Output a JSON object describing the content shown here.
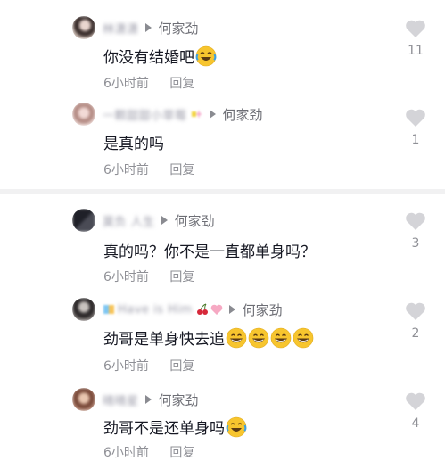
{
  "comments": [
    {
      "username": "林潇潇",
      "reply_to": "何家劲",
      "text": "你没有结婚吧",
      "time": "6小时前",
      "reply_label": "回复",
      "likes": "11",
      "emoji": [
        "laughing-tears-emoji"
      ]
    },
    {
      "username": "一颗甜甜小草莓",
      "reply_to": "何家劲",
      "text": "是真的吗",
      "time": "6小时前",
      "reply_label": "回复",
      "likes": "1",
      "emoji": []
    },
    {
      "username": "莫负 人生",
      "reply_to": "何家劲",
      "text": "真的吗？你不是一直都单身吗？",
      "time": "6小时前",
      "reply_label": "回复",
      "likes": "3",
      "emoji": []
    },
    {
      "username": "Have is Him",
      "reply_to": "何家劲",
      "text": "劲哥是单身快去追",
      "time": "6小时前",
      "reply_label": "回复",
      "likes": "2",
      "emoji": [
        "grinning-emoji",
        "grinning-emoji",
        "grinning-emoji",
        "grinning-emoji"
      ]
    },
    {
      "username": "晴晴星",
      "reply_to": "何家劲",
      "text": "劲哥不是还单身吗",
      "time": "6小时前",
      "reply_label": "回复",
      "likes": "4",
      "emoji": [
        "laughing-tears-emoji"
      ]
    }
  ],
  "colors": {
    "text": "#161823",
    "secondary": "#8f9096",
    "heart": "#d4d4d8",
    "emoji_yellow": "#f7c52e"
  }
}
